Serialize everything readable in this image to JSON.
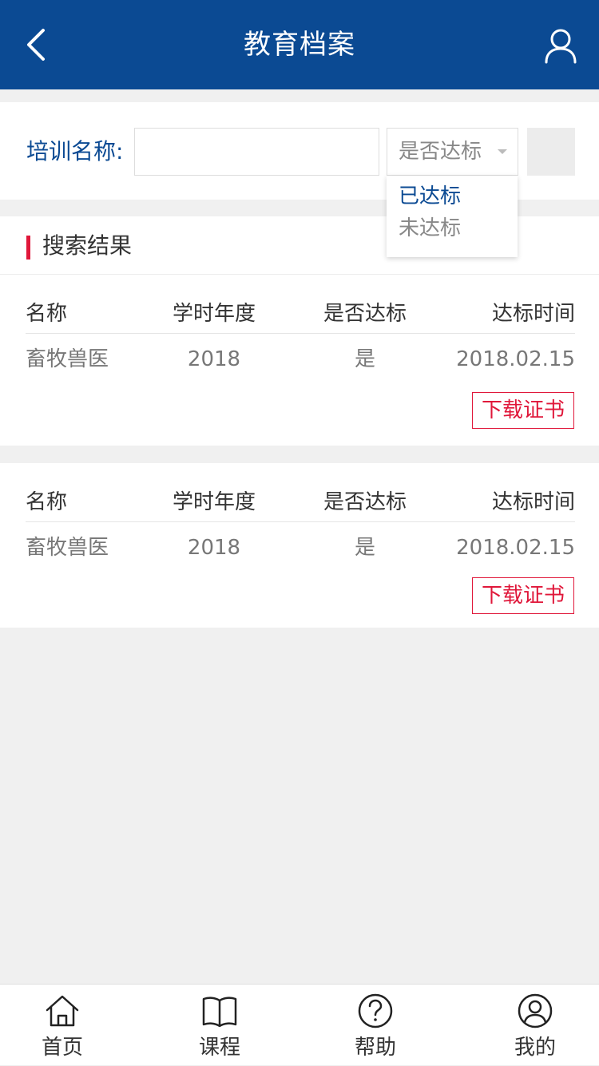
{
  "header": {
    "title": "教育档案",
    "back_icon": "chevron-left-icon",
    "user_icon": "user-icon"
  },
  "search": {
    "label": "培训名称:",
    "input_value": "",
    "input_placeholder": "",
    "status_select": "是否达标",
    "status_options": [
      "已达标",
      "未达标"
    ]
  },
  "results": {
    "title": "搜索结果",
    "columns": [
      "名称",
      "学时年度",
      "是否达标",
      "达标时间"
    ],
    "rows": [
      {
        "name": "畜牧兽医",
        "year": "2018",
        "passed": "是",
        "date": "2018.02.15",
        "action": "下载证书"
      },
      {
        "name": "畜牧兽医",
        "year": "2018",
        "passed": "是",
        "date": "2018.02.15",
        "action": "下载证书"
      }
    ]
  },
  "tabbar": {
    "items": [
      {
        "label": "首页",
        "icon": "home-icon"
      },
      {
        "label": "课程",
        "icon": "book-icon"
      },
      {
        "label": "帮助",
        "icon": "help-icon"
      },
      {
        "label": "我的",
        "icon": "profile-icon"
      }
    ]
  },
  "colors": {
    "brand_blue": "#0b4a93",
    "accent_red": "#e0173a",
    "background": "#f0f0f0"
  }
}
